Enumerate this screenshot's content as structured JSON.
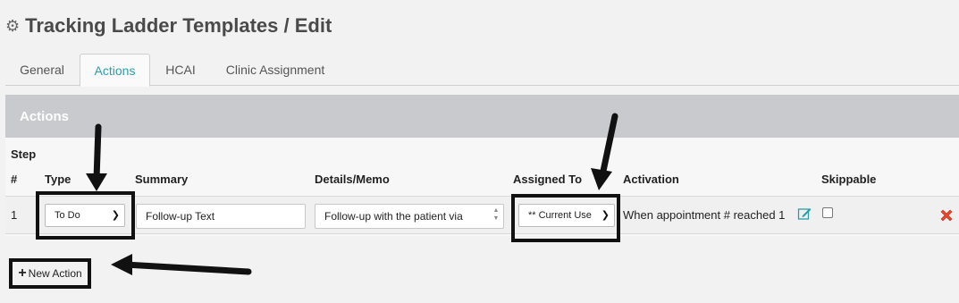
{
  "header": {
    "title": "Tracking Ladder Templates / Edit",
    "icon": "gear-icon"
  },
  "tabs": [
    {
      "label": "General",
      "active": false
    },
    {
      "label": "Actions",
      "active": true
    },
    {
      "label": "HCAI",
      "active": false
    },
    {
      "label": "Clinic Assignment",
      "active": false
    }
  ],
  "panel": {
    "title": "Actions",
    "columns": {
      "step_top": "Step",
      "step": "#",
      "type": "Type",
      "summary": "Summary",
      "details": "Details/Memo",
      "assigned": "Assigned To",
      "activation": "Activation",
      "skippable": "Skippable"
    },
    "row": {
      "number": "1",
      "type_value": "To Do",
      "summary_value": "Follow-up Text",
      "details_value": "Follow-up with the patient via",
      "assigned_value": "** Current Use",
      "activation_text": "When appointment # reached 1",
      "skippable_checked": false
    }
  },
  "new_action_label": "New Action",
  "colors": {
    "accent": "#2a9fa8",
    "header_bar": "#c8cacd",
    "delete": "#e8472b",
    "edit": "#2a9fa8"
  }
}
